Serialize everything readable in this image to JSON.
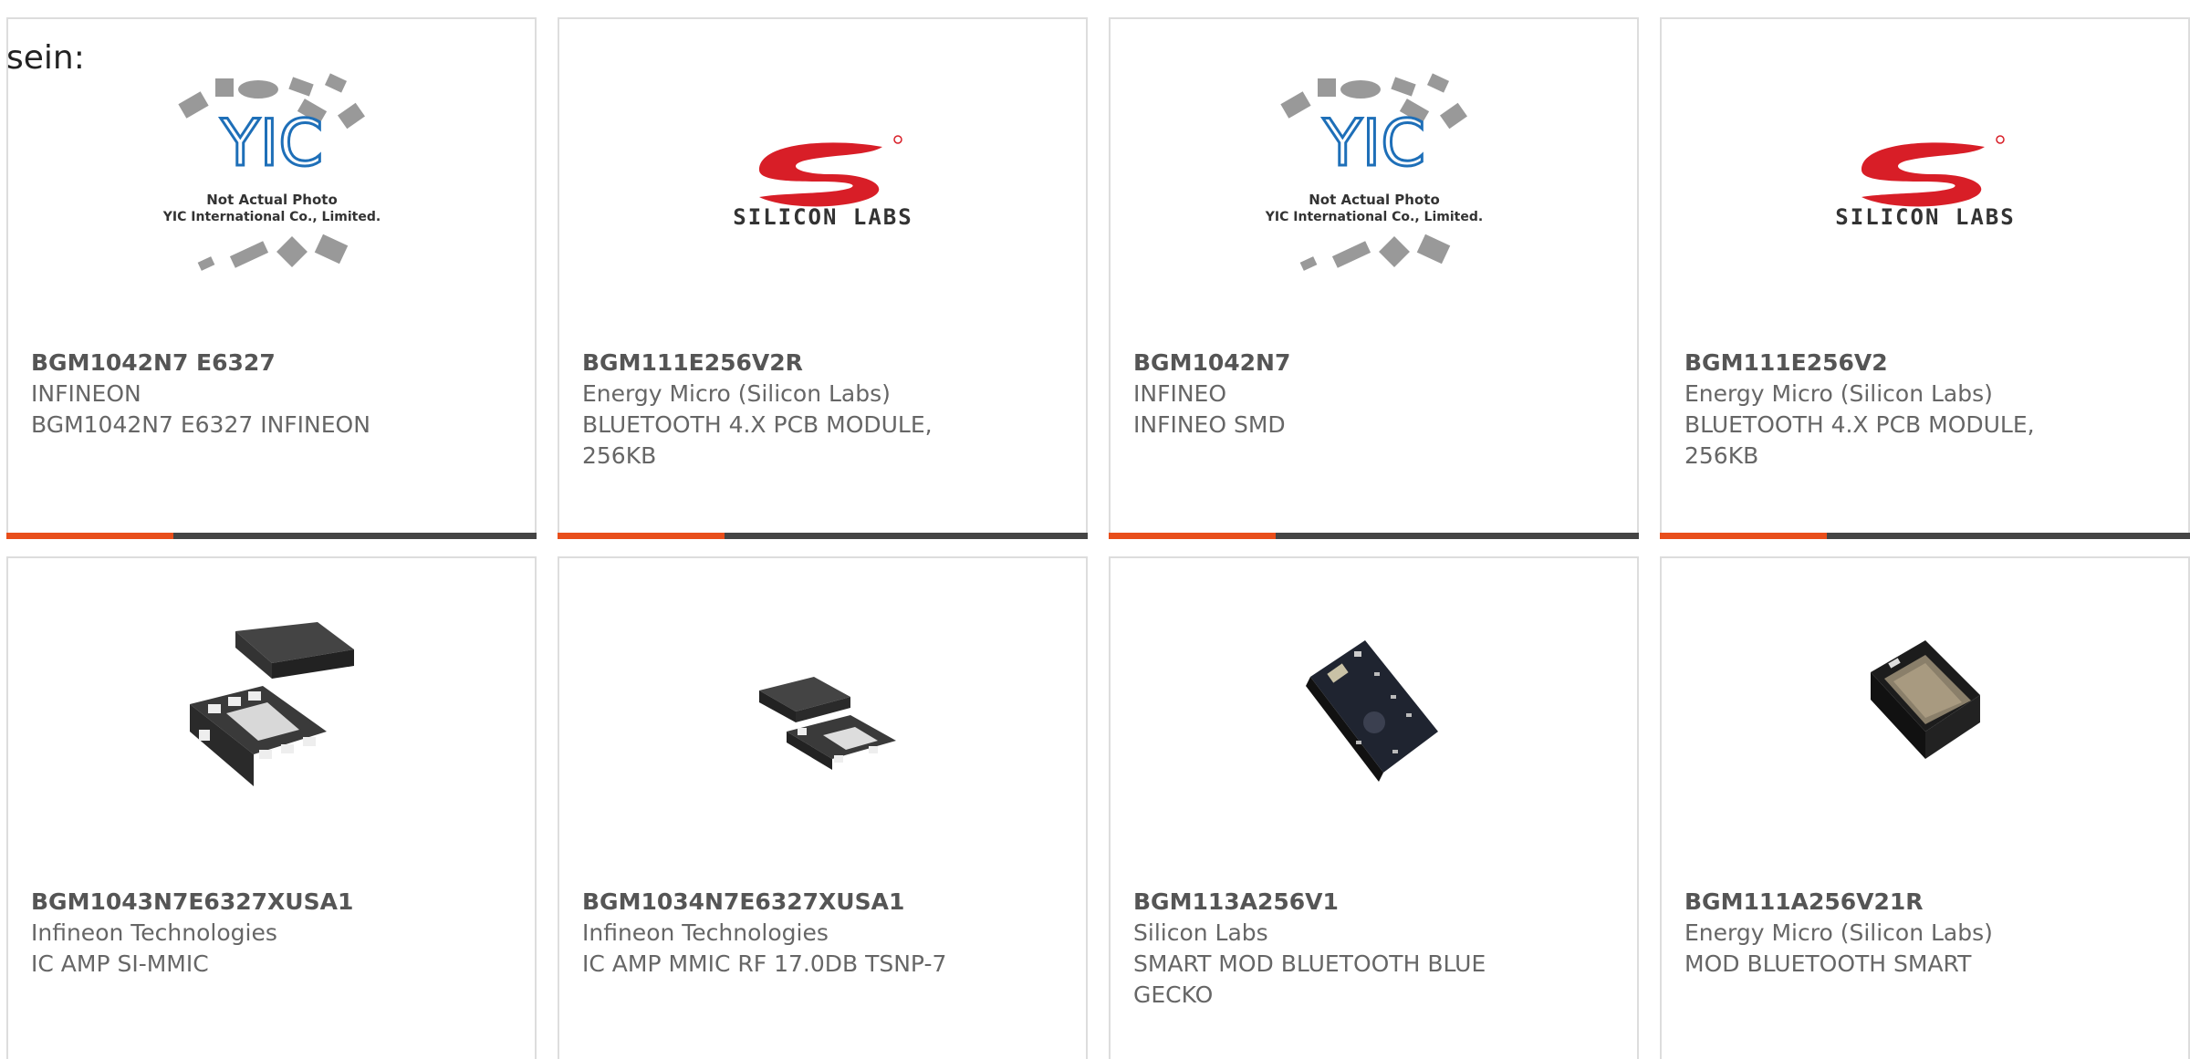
{
  "lead_text": "sein:",
  "colors": {
    "accent": "#e84e1b",
    "bar": "#444444",
    "border": "#dddddd",
    "text": "#666666"
  },
  "cards": [
    {
      "part_number": "BGM1042N7 E6327",
      "manufacturer": "INFINEON",
      "description": "BGM1042N7 E6327 INFINEON",
      "image": "yic-not-actual-photo",
      "image_caption_1": "Not Actual Photo",
      "image_caption_2": "YIC International Co., Limited."
    },
    {
      "part_number": "BGM111E256V2R",
      "manufacturer": "Energy Micro (Silicon Labs)",
      "description": "BLUETOOTH 4.X PCB MODULE, 256KB",
      "image": "silicon-labs-logo",
      "logo_text": "SILICON LABS"
    },
    {
      "part_number": "BGM1042N7",
      "manufacturer": "INFINEO",
      "description": "INFINEO SMD",
      "image": "yic-not-actual-photo",
      "image_caption_1": "Not Actual Photo",
      "image_caption_2": "YIC International Co., Limited."
    },
    {
      "part_number": "BGM111E256V2",
      "manufacturer": "Energy Micro (Silicon Labs)",
      "description": "BLUETOOTH 4.X PCB MODULE, 256KB",
      "image": "silicon-labs-logo",
      "logo_text": "SILICON LABS"
    },
    {
      "part_number": "BGM1043N7E6327XUSA1",
      "manufacturer": "Infineon Technologies",
      "description": "IC AMP SI-MMIC",
      "image": "tsnp-package-large"
    },
    {
      "part_number": "BGM1034N7E6327XUSA1",
      "manufacturer": "Infineon Technologies",
      "description": "IC AMP MMIC RF 17.0DB TSNP-7",
      "image": "tsnp-package-small"
    },
    {
      "part_number": "BGM113A256V1",
      "manufacturer": "Silicon Labs",
      "description": "SMART MOD BLUETOOTH BLUE GECKO",
      "image": "pcb-module-photo"
    },
    {
      "part_number": "BGM111A256V21R",
      "manufacturer": "Energy Micro (Silicon Labs)",
      "description": "MOD BLUETOOTH SMART",
      "image": "shielded-module-photo"
    }
  ]
}
